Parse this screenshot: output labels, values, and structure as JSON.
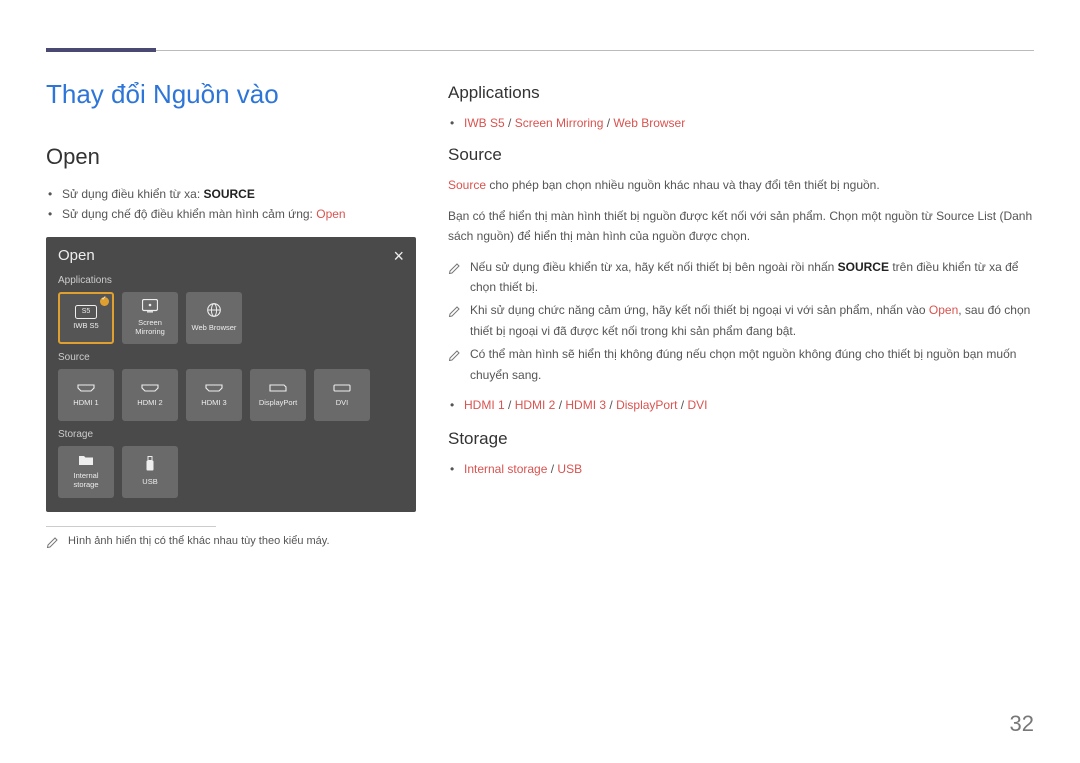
{
  "page_number": "32",
  "chapter_title": "Thay đổi Nguồn vào",
  "left": {
    "h2": "Open",
    "bullet1_pre": "Sử dụng điều khiển từ xa: ",
    "bullet1_strong": "SOURCE",
    "bullet2_pre": "Sử dụng chế độ điều khiển màn hình cảm ứng: ",
    "bullet2_red": "Open",
    "footnote": "Hình ảnh hiển thị có thể khác nhau tùy theo kiểu máy."
  },
  "device": {
    "title": "Open",
    "sec1": "Applications",
    "tile_iwb_box": "S5",
    "tile_iwb": "IWB S5",
    "tile_screen_top": "Screen",
    "tile_screen_bot": "Mirroring",
    "tile_web": "Web Browser",
    "sec2": "Source",
    "tile_h1": "HDMI 1",
    "tile_h2": "HDMI 2",
    "tile_h3": "HDMI 3",
    "tile_dp": "DisplayPort",
    "tile_dvi": "DVI",
    "sec3": "Storage",
    "tile_internal_top": "Internal",
    "tile_internal_bot": "storage",
    "tile_usb": "USB"
  },
  "right": {
    "applications_h": "Applications",
    "apps_red1": "IWB S5",
    "apps_sep": " / ",
    "apps_red2": "Screen Mirroring",
    "apps_red3": "Web Browser",
    "source_h": "Source",
    "source_p1_red": "Source",
    "source_p1_rest": " cho phép bạn chọn nhiều nguồn khác nhau và thay đổi tên thiết bị nguồn.",
    "source_p2": "Bạn có thể hiển thị màn hình thiết bị nguồn được kết nối với sản phẩm. Chọn một nguồn từ Source List (Danh sách nguồn) để hiển thị màn hình của nguồn được chọn.",
    "note1_a": "Nếu sử dụng điều khiển từ xa, hãy kết nối thiết bị bên ngoài rồi nhấn ",
    "note1_strong": "SOURCE",
    "note1_b": " trên điều khiển từ xa để chọn thiết bị.",
    "note2_a": "Khi sử dụng chức năng cảm ứng, hãy kết nối thiết bị ngoại vi với sản phẩm, nhấn vào ",
    "note2_red": "Open",
    "note2_b": ", sau đó chọn thiết bị ngoại vi đã được kết nối trong khi sản phẩm đang bật.",
    "note3": "Có thể màn hình sẽ hiển thị không đúng nếu chọn một nguồn không đúng cho thiết bị nguồn bạn muốn chuyển sang.",
    "src_red1": "HDMI 1",
    "src_red2": "HDMI 2",
    "src_red3": "HDMI 3",
    "src_red4": "DisplayPort",
    "src_red5": "DVI",
    "storage_h": "Storage",
    "stor_red1": "Internal storage",
    "stor_red2": "USB"
  }
}
